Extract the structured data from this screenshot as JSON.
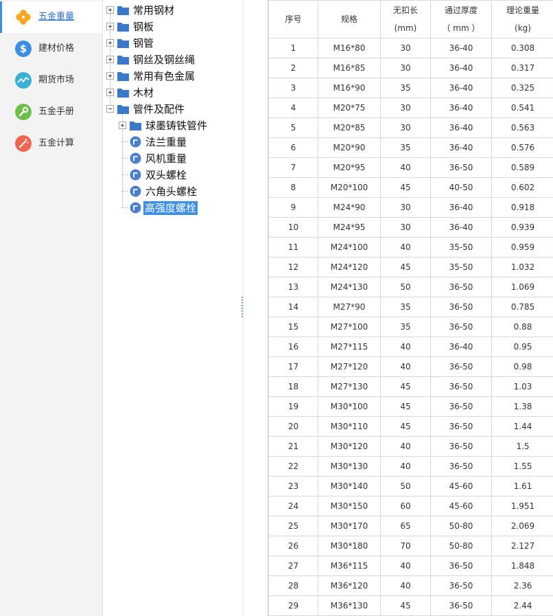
{
  "nav": {
    "items": [
      {
        "label": "五金重量",
        "icon": "clover-icon",
        "color": "#f5a623",
        "active": true
      },
      {
        "label": "建材价格",
        "icon": "dollar-icon",
        "color": "#3a8ee6",
        "active": false
      },
      {
        "label": "期货市场",
        "icon": "trend-line-icon",
        "color": "#3ab0d8",
        "active": false
      },
      {
        "label": "五金手册",
        "icon": "wrench-icon",
        "color": "#6cc04a",
        "active": false
      },
      {
        "label": "五金计算",
        "icon": "magic-wand-icon",
        "color": "#ee6650",
        "active": false
      }
    ]
  },
  "tree": {
    "nodes": [
      {
        "label": "常用钢材",
        "type": "folder",
        "expanded": false
      },
      {
        "label": "钢板",
        "type": "folder",
        "expanded": false
      },
      {
        "label": "钢管",
        "type": "folder",
        "expanded": false
      },
      {
        "label": "钢丝及钢丝绳",
        "type": "folder",
        "expanded": false
      },
      {
        "label": "常用有色金属",
        "type": "folder",
        "expanded": false
      },
      {
        "label": "木材",
        "type": "folder",
        "expanded": false
      },
      {
        "label": "管件及配件",
        "type": "folder",
        "expanded": true
      },
      {
        "label": "球墨铸铁管件",
        "type": "folder",
        "expanded": false,
        "child": true
      },
      {
        "label": "法兰重量",
        "type": "doc",
        "child": true
      },
      {
        "label": "风机重量",
        "type": "doc",
        "child": true
      },
      {
        "label": "双头螺栓",
        "type": "doc",
        "child": true
      },
      {
        "label": "六角头螺栓",
        "type": "doc",
        "child": true
      },
      {
        "label": "高强度螺栓",
        "type": "doc",
        "child": true,
        "selected": true
      }
    ]
  },
  "table": {
    "headers": [
      {
        "line1": "序号",
        "line2": ""
      },
      {
        "line1": "规格",
        "line2": ""
      },
      {
        "line1": "无扣长",
        "line2": "(mm)"
      },
      {
        "line1": "通过厚度",
        "line2": "（ mm ）"
      },
      {
        "line1": "理论重量",
        "line2": "(kg)"
      }
    ],
    "rows": [
      [
        "1",
        "M16*80",
        "30",
        "36-40",
        "0.308"
      ],
      [
        "2",
        "M16*85",
        "30",
        "36-40",
        "0.317"
      ],
      [
        "3",
        "M16*90",
        "35",
        "36-40",
        "0.325"
      ],
      [
        "4",
        "M20*75",
        "30",
        "36-40",
        "0.541"
      ],
      [
        "5",
        "M20*85",
        "30",
        "36-40",
        "0.563"
      ],
      [
        "6",
        "M20*90",
        "35",
        "36-40",
        "0.576"
      ],
      [
        "7",
        "M20*95",
        "40",
        "36-50",
        "0.589"
      ],
      [
        "8",
        "M20*100",
        "45",
        "40-50",
        "0.602"
      ],
      [
        "9",
        "M24*90",
        "30",
        "36-40",
        "0.918"
      ],
      [
        "10",
        "M24*95",
        "30",
        "36-40",
        "0.939"
      ],
      [
        "11",
        "M24*100",
        "40",
        "35-50",
        "0.959"
      ],
      [
        "12",
        "M24*120",
        "45",
        "35-50",
        "1.032"
      ],
      [
        "13",
        "M24*130",
        "50",
        "36-50",
        "1.069"
      ],
      [
        "14",
        "M27*90",
        "35",
        "36-50",
        "0.785"
      ],
      [
        "15",
        "M27*100",
        "35",
        "36-50",
        "0.88"
      ],
      [
        "16",
        "M27*115",
        "40",
        "36-40",
        "0.95"
      ],
      [
        "17",
        "M27*120",
        "40",
        "36-50",
        "0.98"
      ],
      [
        "18",
        "M27*130",
        "45",
        "36-50",
        "1.03"
      ],
      [
        "19",
        "M30*100",
        "45",
        "36-50",
        "1.38"
      ],
      [
        "20",
        "M30*110",
        "45",
        "36-50",
        "1.44"
      ],
      [
        "21",
        "M30*120",
        "40",
        "36-50",
        "1.5"
      ],
      [
        "22",
        "M30*130",
        "40",
        "36-50",
        "1.55"
      ],
      [
        "23",
        "M30*140",
        "50",
        "45-60",
        "1.61"
      ],
      [
        "24",
        "M30*150",
        "60",
        "45-60",
        "1.951"
      ],
      [
        "25",
        "M30*170",
        "65",
        "50-80",
        "2.069"
      ],
      [
        "26",
        "M30*180",
        "70",
        "50-80",
        "2.127"
      ],
      [
        "27",
        "M36*115",
        "40",
        "36-50",
        "1.848"
      ],
      [
        "28",
        "M36*120",
        "40",
        "36-50",
        "2.36"
      ],
      [
        "29",
        "M36*130",
        "45",
        "36-50",
        "2.44"
      ]
    ]
  }
}
